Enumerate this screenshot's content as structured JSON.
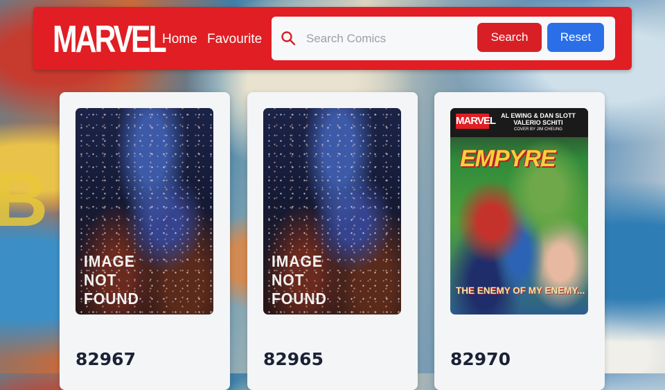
{
  "navbar": {
    "logo": "MARVEL",
    "links": [
      {
        "label": "Home"
      },
      {
        "label": "Favourite"
      }
    ]
  },
  "search": {
    "placeholder": "Search Comics",
    "value": "",
    "search_label": "Search",
    "reset_label": "Reset"
  },
  "comics": [
    {
      "id": "82967",
      "image_text": [
        "IMAGE",
        "NOT",
        "FOUND"
      ]
    },
    {
      "id": "82965",
      "image_text": [
        "IMAGE",
        "NOT",
        "FOUND"
      ]
    },
    {
      "id": "82970",
      "cover": {
        "brand": "MARVEL",
        "credits": [
          "AL EWING & DAN SLOTT",
          "VALERIO SCHITI",
          "COVER BY JIM CHEUNG"
        ],
        "title": "EMPYRE",
        "tagline": "THE ENEMY OF MY ENEMY..."
      }
    }
  ],
  "colors": {
    "navbar": "#e01e24",
    "search_button": "#d81f26",
    "reset_button": "#2a6fe8",
    "card": "#f4f5f7"
  }
}
